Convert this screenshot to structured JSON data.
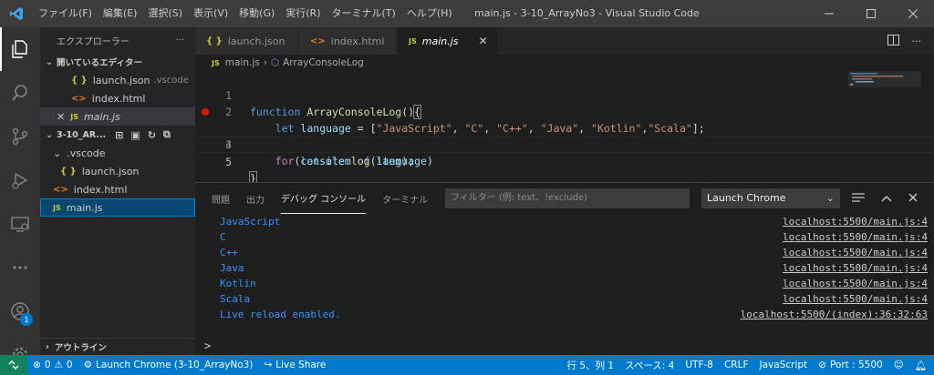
{
  "titlebar": {
    "menu": [
      "ファイル(F)",
      "編集(E)",
      "選択(S)",
      "表示(V)",
      "移動(G)",
      "実行(R)",
      "ターミナル(T)",
      "ヘルプ(H)"
    ],
    "title": "main.js - 3-10_ArrayNo3 - Visual Studio Code"
  },
  "sidebar": {
    "header": "エクスプローラー",
    "open_editors": "開いているエディター",
    "open_files": [
      {
        "icon": "{ }",
        "name": "launch.json",
        "detail": ".vscode"
      },
      {
        "icon": "<>",
        "name": "index.html",
        "detail": ""
      },
      {
        "icon": "JS",
        "name": "main.js",
        "detail": ""
      }
    ],
    "folder": "3-10_AR...",
    "tree": [
      {
        "name": ".vscode"
      },
      {
        "name": "launch.json"
      },
      {
        "name": "index.html"
      },
      {
        "name": "main.js"
      }
    ],
    "outline": "アウトライン"
  },
  "tabs": [
    {
      "label": "launch.json"
    },
    {
      "label": "index.html"
    },
    {
      "label": "main.js"
    }
  ],
  "breadcrumb": {
    "file": "main.js",
    "symbol": "ArrayConsoleLog"
  },
  "editor": {
    "line_numbers": [
      "1",
      "2",
      "3",
      "4",
      "5"
    ]
  },
  "panel": {
    "tabs": [
      "問題",
      "出力",
      "デバッグ コンソール",
      "ターミナル"
    ],
    "filter_placeholder": "フィルター (例: text、!exclude)",
    "launch_config": "Launch Chrome",
    "output": [
      {
        "text": "JavaScript",
        "source": "localhost:5500/main.js:4"
      },
      {
        "text": "C",
        "source": "localhost:5500/main.js:4"
      },
      {
        "text": "C++",
        "source": "localhost:5500/main.js:4"
      },
      {
        "text": "Java",
        "source": "localhost:5500/main.js:4"
      },
      {
        "text": "Kotlin",
        "source": "localhost:5500/main.js:4"
      },
      {
        "text": "Scala",
        "source": "localhost:5500/main.js:4"
      },
      {
        "text": "Live reload enabled.",
        "source": "localhost:5500/(index):36:32:63"
      }
    ],
    "prompt": ">"
  },
  "status": {
    "errors": "0",
    "warnings": "0",
    "debug": "Launch Chrome (3-10_ArrayNo3)",
    "liveshare": "Live Share",
    "position": "行 5、列 1",
    "spaces": "スペース: 4",
    "encoding": "UTF-8",
    "eol": "CRLF",
    "language": "JavaScript",
    "port": "Port : 5500"
  },
  "activity": {
    "badge": "1"
  },
  "colors": {
    "accent": "#007acc",
    "statusbar": "#007acc",
    "remote": "#16825d",
    "breakpoint": "#e51400"
  }
}
